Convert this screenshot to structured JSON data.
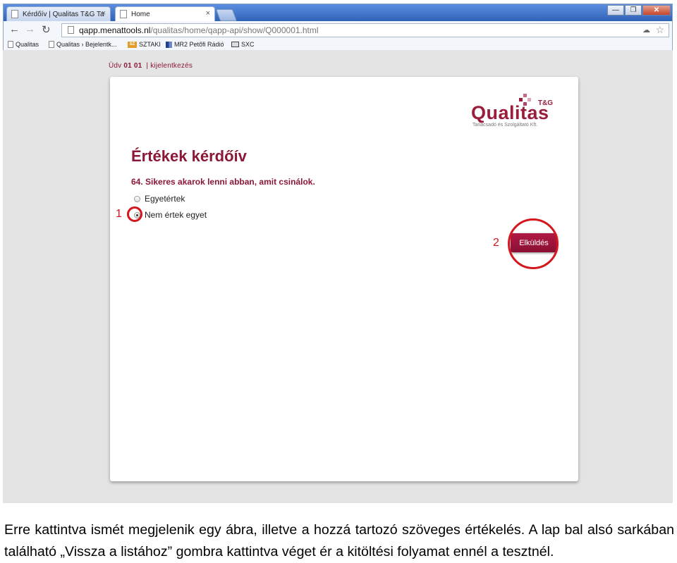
{
  "browser": {
    "tabs": [
      {
        "label": "Kérdőív | Qualitas T&G Ta",
        "close": "×"
      },
      {
        "label": "Home",
        "close": "×"
      }
    ],
    "window_buttons": {
      "minimize": "—",
      "restore": "❐",
      "close": "✕"
    },
    "nav": {
      "back": "←",
      "forward": "→",
      "reload": "↻"
    },
    "url": {
      "host": "qapp.menattools.nl",
      "path": "/qualitas/home/qapp-api/show/Q000001.html"
    },
    "bookmarks": [
      "Qualitas",
      "Qualitas › Bejelentk...",
      "SZTAKI",
      "MR2 Petőfi Rádió",
      "SXC"
    ],
    "sz_badge": "SZ"
  },
  "page": {
    "greeting": {
      "prefix": "Üdv",
      "user": "01 01",
      "separator": "|",
      "logout": "kijelentkezés"
    },
    "logo": {
      "word": "Qualitas",
      "tg": "T&G",
      "subtitle": "Tanácsadó és Szolgáltató Kft."
    },
    "form_title": "Értékek kérdőív",
    "question": "64. Sikeres akarok lenni abban, amit csinálok.",
    "options": [
      {
        "label": "Egyetértek",
        "checked": false
      },
      {
        "label": "Nem értek egyet",
        "checked": true
      }
    ],
    "submit_label": "Elküldés",
    "markers": [
      "1",
      "2"
    ],
    "colors": {
      "brand": "#8b1836",
      "annotation": "#d4161f"
    }
  },
  "caption": "Erre kattintva ismét megjelenik egy ábra, illetve a hozzá tartozó szöveges értékelés. A lap bal alsó sarkában található „Vissza a listához” gombra kattintva véget ér a kitöltési folyamat ennél a tesztnél."
}
